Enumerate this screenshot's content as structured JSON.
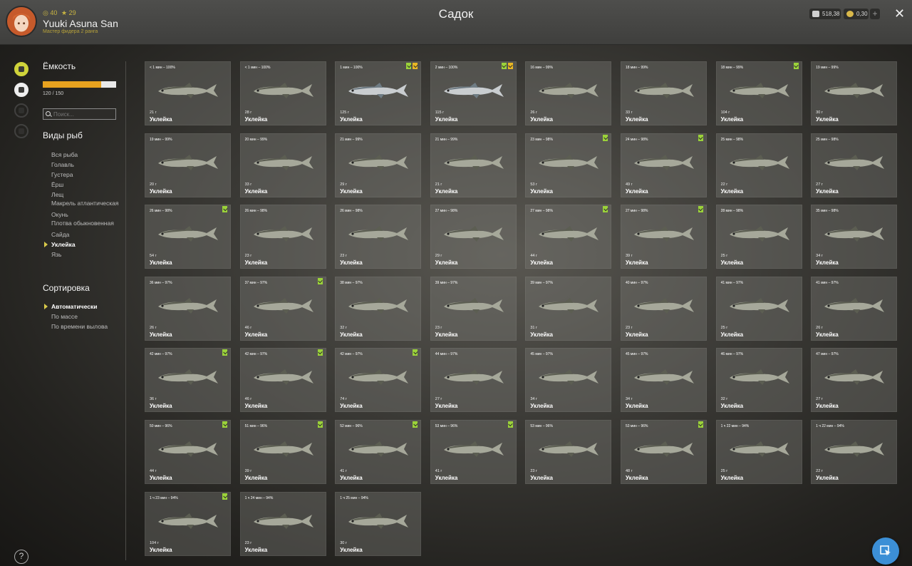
{
  "header": {
    "title": "Садок",
    "player_level": "40",
    "player_rank": "29",
    "player_name": "Yuuki Asuna San",
    "player_title": "Мастер фидера 2 ранга",
    "silver": "518,38",
    "gold": "0,30",
    "plus_label": "+",
    "close_label": "✕"
  },
  "sidebar": {
    "capacity_heading": "Ёмкость",
    "capacity_text": "120 / 150",
    "capacity_fraction": 0.8,
    "search_placeholder": "Поиск...",
    "species_heading": "Виды рыб",
    "species": [
      "Вся рыба",
      "Голавль",
      "Густера",
      "Ёрш",
      "Лещ",
      "Макрель атлантическая",
      "Окунь",
      "Плотва обыкновенная",
      "Сайда",
      "Уклейка",
      "Язь"
    ],
    "selected_species": "Уклейка",
    "sort_heading": "Сортировка",
    "sort_options": [
      "Автоматически",
      "По массе",
      "По времени вылова"
    ],
    "selected_sort": "Автоматически",
    "help_label": "?"
  },
  "fish": [
    {
      "info": "< 1 мин – 100%",
      "weight": "21 г",
      "name": "Уклейка",
      "badges": [],
      "big": false
    },
    {
      "info": "< 1 мин – 100%",
      "weight": "28 г",
      "name": "Уклейка",
      "badges": [],
      "big": false
    },
    {
      "info": "1 мин – 100%",
      "weight": "125 г",
      "name": "Уклейка",
      "badges": [
        "green",
        "gold"
      ],
      "big": true
    },
    {
      "info": "2 мин – 100%",
      "weight": "115 г",
      "name": "Уклейка",
      "badges": [
        "green",
        "gold"
      ],
      "big": true
    },
    {
      "info": "16 мин – 99%",
      "weight": "26 г",
      "name": "Уклейка",
      "badges": [],
      "big": false
    },
    {
      "info": "18 мин – 99%",
      "weight": "33 г",
      "name": "Уклейка",
      "badges": [],
      "big": false
    },
    {
      "info": "18 мин – 99%",
      "weight": "104 г",
      "name": "Уклейка",
      "badges": [
        "green"
      ],
      "big": false
    },
    {
      "info": "19 мин – 99%",
      "weight": "30 г",
      "name": "Уклейка",
      "badges": [],
      "big": false
    },
    {
      "info": "19 мин – 99%",
      "weight": "20 г",
      "name": "Уклейка",
      "badges": [],
      "big": false
    },
    {
      "info": "20 мин – 99%",
      "weight": "33 г",
      "name": "Уклейка",
      "badges": [],
      "big": false
    },
    {
      "info": "21 мин – 99%",
      "weight": "29 г",
      "name": "Уклейка",
      "badges": [],
      "big": false
    },
    {
      "info": "21 мин – 99%",
      "weight": "21 г",
      "name": "Уклейка",
      "badges": [],
      "big": false
    },
    {
      "info": "23 мин – 98%",
      "weight": "53 г",
      "name": "Уклейка",
      "badges": [
        "green"
      ],
      "big": false
    },
    {
      "info": "24 мин – 98%",
      "weight": "49 г",
      "name": "Уклейка",
      "badges": [
        "green"
      ],
      "big": false
    },
    {
      "info": "25 мин – 98%",
      "weight": "22 г",
      "name": "Уклейка",
      "badges": [],
      "big": false
    },
    {
      "info": "25 мин – 98%",
      "weight": "27 г",
      "name": "Уклейка",
      "badges": [],
      "big": false
    },
    {
      "info": "26 мин – 98%",
      "weight": "54 г",
      "name": "Уклейка",
      "badges": [
        "green"
      ],
      "big": false
    },
    {
      "info": "26 мин – 98%",
      "weight": "23 г",
      "name": "Уклейка",
      "badges": [],
      "big": false
    },
    {
      "info": "26 мин – 98%",
      "weight": "23 г",
      "name": "Уклейка",
      "badges": [],
      "big": false
    },
    {
      "info": "27 мин – 98%",
      "weight": "29 г",
      "name": "Уклейка",
      "badges": [],
      "big": false
    },
    {
      "info": "27 мин – 98%",
      "weight": "44 г",
      "name": "Уклейка",
      "badges": [
        "green"
      ],
      "big": false
    },
    {
      "info": "27 мин – 98%",
      "weight": "39 г",
      "name": "Уклейка",
      "badges": [
        "green"
      ],
      "big": false
    },
    {
      "info": "28 мин – 98%",
      "weight": "25 г",
      "name": "Уклейка",
      "badges": [],
      "big": false
    },
    {
      "info": "35 мин – 98%",
      "weight": "34 г",
      "name": "Уклейка",
      "badges": [],
      "big": false
    },
    {
      "info": "36 мин – 97%",
      "weight": "26 г",
      "name": "Уклейка",
      "badges": [],
      "big": false
    },
    {
      "info": "37 мин – 97%",
      "weight": "46 г",
      "name": "Уклейка",
      "badges": [
        "green"
      ],
      "big": false
    },
    {
      "info": "38 мин – 97%",
      "weight": "32 г",
      "name": "Уклейка",
      "badges": [],
      "big": false
    },
    {
      "info": "39 мин – 97%",
      "weight": "23 г",
      "name": "Уклейка",
      "badges": [],
      "big": false
    },
    {
      "info": "39 мин – 97%",
      "weight": "31 г",
      "name": "Уклейка",
      "badges": [],
      "big": false
    },
    {
      "info": "40 мин – 97%",
      "weight": "23 г",
      "name": "Уклейка",
      "badges": [],
      "big": false
    },
    {
      "info": "41 мин – 97%",
      "weight": "25 г",
      "name": "Уклейка",
      "badges": [],
      "big": false
    },
    {
      "info": "41 мин – 97%",
      "weight": "26 г",
      "name": "Уклейка",
      "badges": [],
      "big": false
    },
    {
      "info": "42 мин – 97%",
      "weight": "36 г",
      "name": "Уклейка",
      "badges": [
        "green"
      ],
      "big": false
    },
    {
      "info": "42 мин – 97%",
      "weight": "46 г",
      "name": "Уклейка",
      "badges": [
        "green"
      ],
      "big": false
    },
    {
      "info": "42 мин – 97%",
      "weight": "74 г",
      "name": "Уклейка",
      "badges": [
        "green"
      ],
      "big": false
    },
    {
      "info": "44 мин – 97%",
      "weight": "27 г",
      "name": "Уклейка",
      "badges": [],
      "big": false
    },
    {
      "info": "45 мин – 97%",
      "weight": "34 г",
      "name": "Уклейка",
      "badges": [],
      "big": false
    },
    {
      "info": "45 мин – 97%",
      "weight": "34 г",
      "name": "Уклейка",
      "badges": [],
      "big": false
    },
    {
      "info": "46 мин – 97%",
      "weight": "32 г",
      "name": "Уклейка",
      "badges": [],
      "big": false
    },
    {
      "info": "47 мин – 97%",
      "weight": "27 г",
      "name": "Уклейка",
      "badges": [],
      "big": false
    },
    {
      "info": "50 мин – 96%",
      "weight": "44 г",
      "name": "Уклейка",
      "badges": [
        "green"
      ],
      "big": false
    },
    {
      "info": "51 мин – 96%",
      "weight": "39 г",
      "name": "Уклейка",
      "badges": [
        "green"
      ],
      "big": false
    },
    {
      "info": "52 мин – 96%",
      "weight": "41 г",
      "name": "Уклейка",
      "badges": [
        "green"
      ],
      "big": false
    },
    {
      "info": "53 мин – 96%",
      "weight": "41 г",
      "name": "Уклейка",
      "badges": [
        "green"
      ],
      "big": false
    },
    {
      "info": "53 мин – 96%",
      "weight": "23 г",
      "name": "Уклейка",
      "badges": [],
      "big": false
    },
    {
      "info": "53 мин – 96%",
      "weight": "48 г",
      "name": "Уклейка",
      "badges": [
        "green"
      ],
      "big": false
    },
    {
      "info": "1 ч 22 мин – 94%",
      "weight": "25 г",
      "name": "Уклейка",
      "badges": [],
      "big": false
    },
    {
      "info": "1 ч 22 мин – 94%",
      "weight": "22 г",
      "name": "Уклейка",
      "badges": [],
      "big": false
    },
    {
      "info": "1 ч 23 мин – 94%",
      "weight": "104 г",
      "name": "Уклейка",
      "badges": [
        "green"
      ],
      "big": false
    },
    {
      "info": "1 ч 24 мин – 94%",
      "weight": "23 г",
      "name": "Уклейка",
      "badges": [],
      "big": false
    },
    {
      "info": "1 ч 25 мин – 94%",
      "weight": "30 г",
      "name": "Уклейка",
      "badges": [],
      "big": false
    }
  ],
  "colors": {
    "accent": "#e7a21f",
    "badge_green": "#9bd23a",
    "badge_gold": "#e8b624",
    "fab": "#3c8fd6"
  }
}
